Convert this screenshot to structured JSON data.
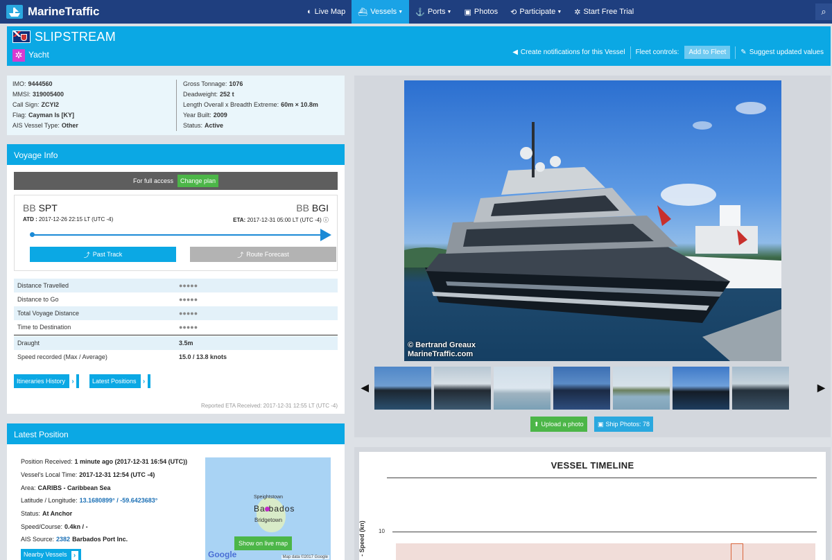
{
  "nav": {
    "brand": "MarineTraffic",
    "items": [
      {
        "label": "Live Map",
        "icon": "globe-icon"
      },
      {
        "label": "Vessels",
        "icon": "ship-icon"
      },
      {
        "label": "Ports",
        "icon": "anchor-icon"
      },
      {
        "label": "Photos",
        "icon": "camera-icon"
      },
      {
        "label": "Participate",
        "icon": "refresh-icon"
      },
      {
        "label": "Start Free Trial",
        "icon": "wheel-icon"
      }
    ],
    "active": "Vessels"
  },
  "vessel": {
    "name": "SLIPSTREAM",
    "type": "Yacht",
    "notify_label": "Create notifications for this Vessel",
    "fleet_controls_label": "Fleet controls:",
    "add_fleet_label": "Add to Fleet",
    "suggest_label": "Suggest updated values"
  },
  "particulars": {
    "left": [
      {
        "label": "IMO:",
        "value": "9444560"
      },
      {
        "label": "MMSI:",
        "value": "319005400"
      },
      {
        "label": "Call Sign:",
        "value": "ZCYI2"
      },
      {
        "label": "Flag:",
        "value": "Cayman Is [KY]"
      },
      {
        "label": "AIS Vessel Type:",
        "value": "Other"
      }
    ],
    "right": [
      {
        "label": "Gross Tonnage:",
        "value": "1076"
      },
      {
        "label": "Deadweight:",
        "value": "252 t"
      },
      {
        "label": "Length Overall x Breadth Extreme:",
        "value": "60m × 10.8m"
      },
      {
        "label": "Year Built:",
        "value": "2009"
      },
      {
        "label": "Status:",
        "value": "Active"
      }
    ]
  },
  "voyage": {
    "title": "Voyage Info",
    "full_access_label": "For full access",
    "change_plan_label": "Change plan",
    "from_cc": "BB",
    "from_port": "SPT",
    "to_cc": "BB",
    "to_port": "BGI",
    "atd_label": "ATD :",
    "atd_value": "2017-12-26 22:15 LT (UTC -4)",
    "eta_label": "ETA:",
    "eta_value": "2017-12-31 05:00 LT (UTC -4)",
    "past_track_label": "Past Track",
    "route_forecast_label": "Route Forecast",
    "rows": [
      {
        "label": "Distance Travelled",
        "value": "●●●●●"
      },
      {
        "label": "Distance to Go",
        "value": "●●●●●"
      },
      {
        "label": "Total Voyage Distance",
        "value": "●●●●●"
      },
      {
        "label": "Time to Destination",
        "value": "●●●●●"
      }
    ],
    "rows2": [
      {
        "label": "Draught",
        "value": "3.5m"
      },
      {
        "label": "Speed recorded (Max / Average)",
        "value": "15.0 / 13.8 knots"
      }
    ],
    "itineraries_label": "Itineraries History",
    "latest_positions_label": "Latest Positions",
    "reported_eta": "Reported ETA Received: 2017-12-31 12:55 LT (UTC -4)"
  },
  "position": {
    "title": "Latest Position",
    "rows": [
      {
        "label": "Position Received:",
        "value": "1 minute ago (2017-12-31 16:54 (UTC))"
      },
      {
        "label": "Vessel's Local Time:",
        "value": "2017-12-31 12:54 (UTC -4)"
      },
      {
        "label": "Area:",
        "value": "CARIBS - Caribbean Sea"
      },
      {
        "label": "Latitude / Longitude:",
        "value": "13.1680899° / -59.6423683°"
      },
      {
        "label": "Status:",
        "value": "At Anchor"
      },
      {
        "label": "Speed/Course:",
        "value": "0.4kn / -"
      },
      {
        "label": "AIS Source:",
        "value": "Barbados Port Inc.",
        "source_id": "2382"
      }
    ],
    "nearby_label": "Nearby Vessels",
    "map": {
      "label_north": "Speightstown",
      "label_island": "Barbados",
      "label_city": "Bridgetown",
      "button": "Show on live map",
      "google": "Google",
      "data": "Map data ©2017 Google"
    }
  },
  "photos": {
    "credit_line1": "© Bertrand Greaux",
    "credit_line2": "MarineTraffic.com",
    "upload_label": "Upload a photo",
    "ship_photos_label": "Ship Photos: 78",
    "thumb_count": 7
  },
  "timeline": {
    "title": "VESSEL TIMELINE",
    "ylabel": "- Speed (kn)",
    "tick": "10"
  }
}
